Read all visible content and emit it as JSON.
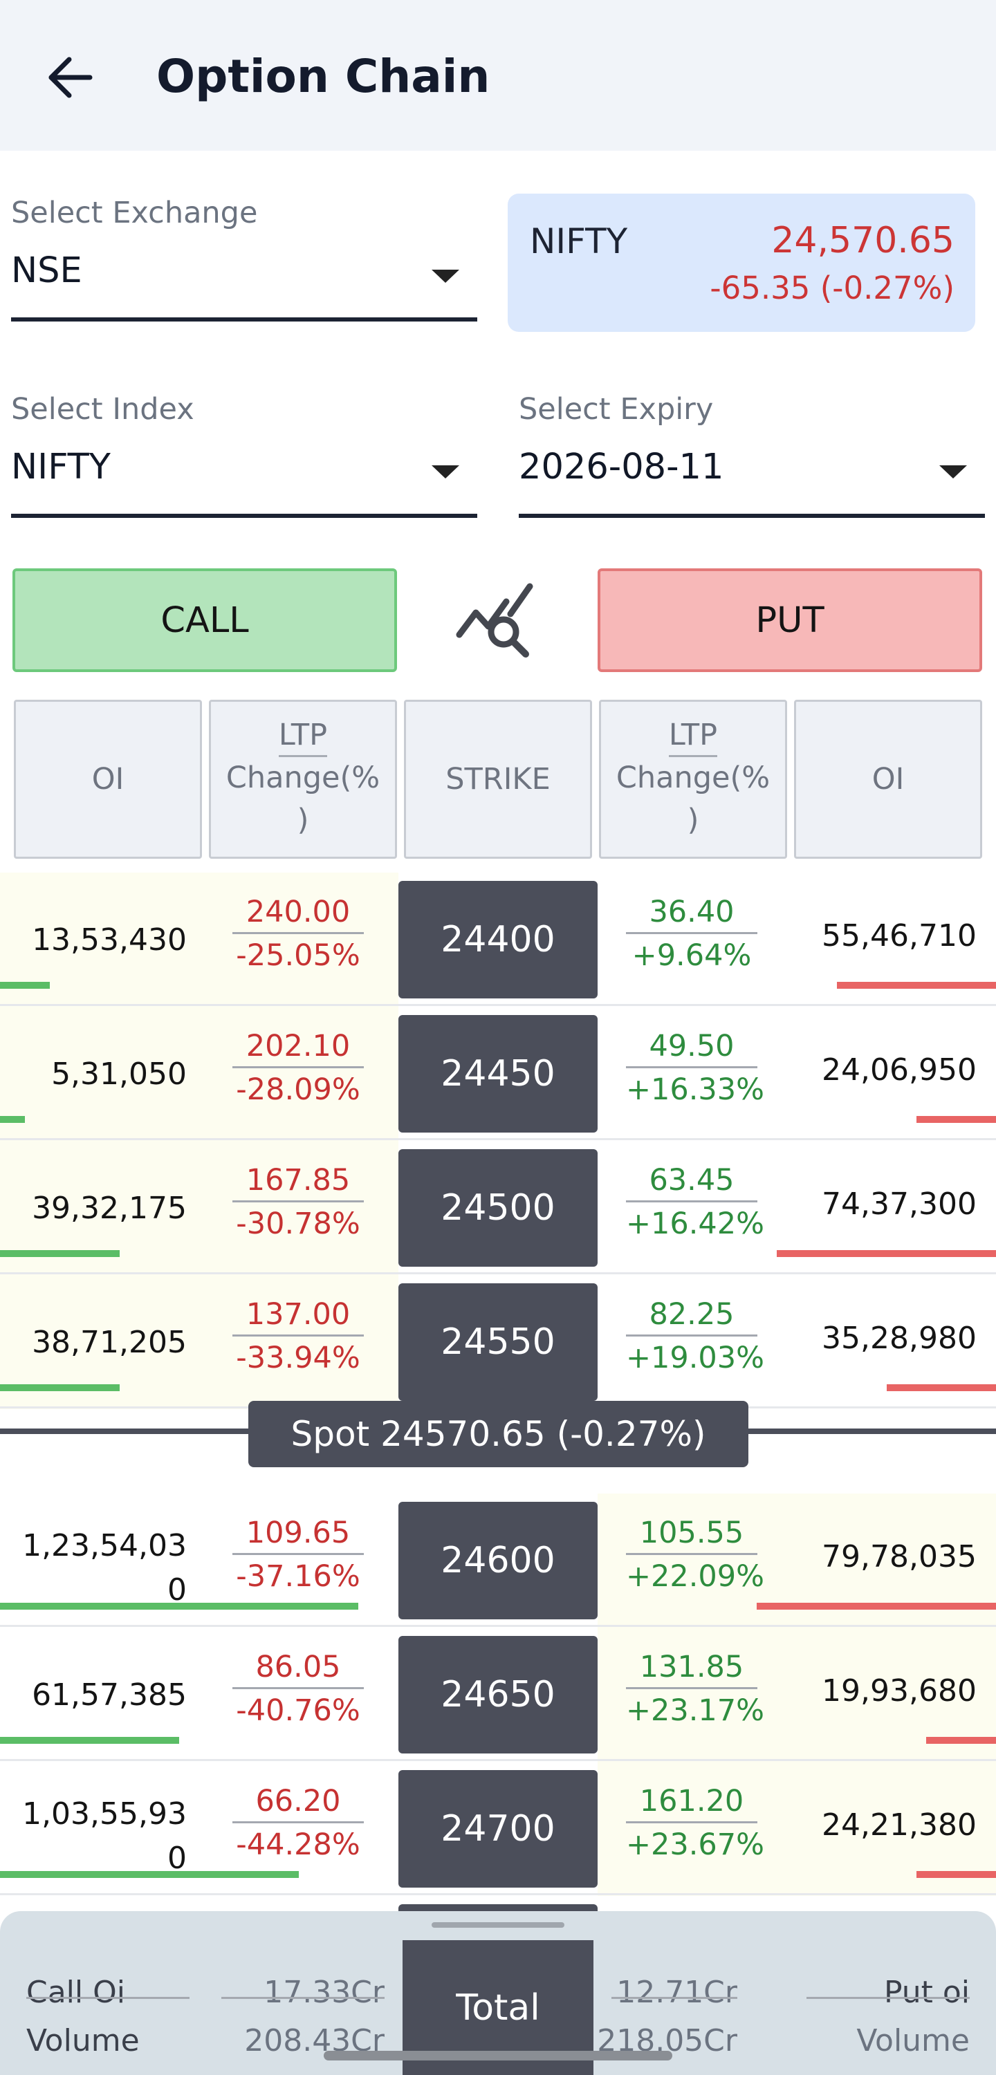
{
  "header": {
    "title": "Option Chain"
  },
  "selectors": {
    "exchange": {
      "label": "Select Exchange",
      "value": "NSE"
    },
    "index": {
      "label": "Select Index",
      "value": "NIFTY"
    },
    "expiry": {
      "label": "Select Expiry",
      "value": "2026-08-11"
    }
  },
  "index_quote": {
    "name": "NIFTY",
    "price": "24,570.65",
    "change": "-65.35 (-0.27%)"
  },
  "buttons": {
    "call": "CALL",
    "put": "PUT"
  },
  "columns": {
    "oi": "OI",
    "ltp": "LTP",
    "change": "Change(%\n)",
    "strike": "STRIKE"
  },
  "rows": [
    {
      "call_oi": "13,53,430",
      "call_ltp": "240.00",
      "call_chg": "-25.05%",
      "strike": "24400",
      "put_ltp": "36.40",
      "put_chg": "+9.64%",
      "put_oi": "55,46,710",
      "call_bar": 0.05,
      "put_bar": 0.16
    },
    {
      "call_oi": "5,31,050",
      "call_ltp": "202.10",
      "call_chg": "-28.09%",
      "strike": "24450",
      "put_ltp": "49.50",
      "put_chg": "+16.33%",
      "put_oi": "24,06,950",
      "call_bar": 0.025,
      "put_bar": 0.08
    },
    {
      "call_oi": "39,32,175",
      "call_ltp": "167.85",
      "call_chg": "-30.78%",
      "strike": "24500",
      "put_ltp": "63.45",
      "put_chg": "+16.42%",
      "put_oi": "74,37,300",
      "call_bar": 0.12,
      "put_bar": 0.22
    },
    {
      "call_oi": "38,71,205",
      "call_ltp": "137.00",
      "call_chg": "-33.94%",
      "strike": "24550",
      "put_ltp": "82.25",
      "put_chg": "+19.03%",
      "put_oi": "35,28,980",
      "call_bar": 0.12,
      "put_bar": 0.11
    },
    {
      "call_oi": "1,23,54,03\n0",
      "call_ltp": "109.65",
      "call_chg": "-37.16%",
      "strike": "24600",
      "put_ltp": "105.55",
      "put_chg": "+22.09%",
      "put_oi": "79,78,035",
      "call_bar": 0.36,
      "put_bar": 0.24
    },
    {
      "call_oi": "61,57,385",
      "call_ltp": "86.05",
      "call_chg": "-40.76%",
      "strike": "24650",
      "put_ltp": "131.85",
      "put_chg": "+23.17%",
      "put_oi": "19,93,680",
      "call_bar": 0.18,
      "put_bar": 0.07
    },
    {
      "call_oi": "1,03,55,93\n0",
      "call_ltp": "66.20",
      "call_chg": "-44.28%",
      "strike": "24700",
      "put_ltp": "161.20",
      "put_chg": "+23.67%",
      "put_oi": "24,21,380",
      "call_bar": 0.3,
      "put_bar": 0.08
    }
  ],
  "spot": {
    "label": "Spot 24570.65 (-0.27%)"
  },
  "footer": {
    "call_oi_label": "Call Oi",
    "call_oi_value": "17.33Cr",
    "call_volume_label": "Volume",
    "call_volume_value": "208.43Cr",
    "total_label": "Total",
    "put_oi_value": "12.71Cr",
    "put_volume_value": "218.05Cr",
    "put_oi_label": "Put oi",
    "put_volume_label": "Volume"
  }
}
